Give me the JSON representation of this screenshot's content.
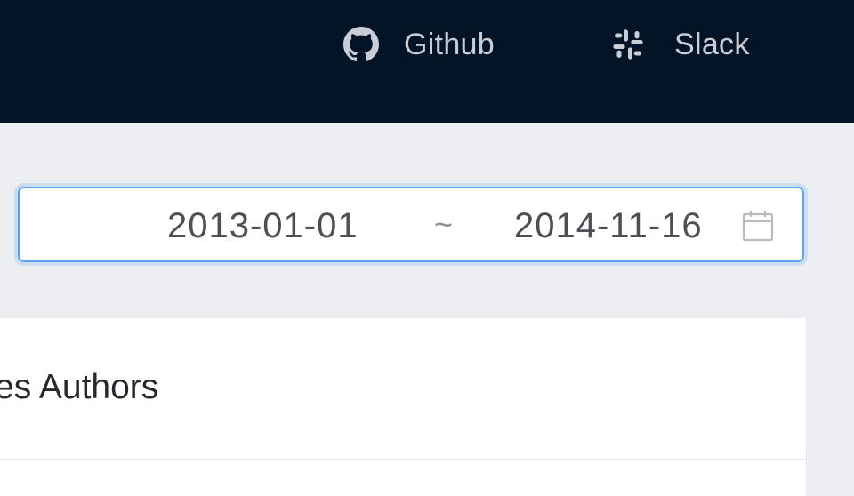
{
  "header": {
    "links": [
      {
        "label": "Github",
        "icon": "github-icon"
      },
      {
        "label": "Slack",
        "icon": "slack-icon"
      }
    ]
  },
  "date_range": {
    "start": "2013-01-01",
    "separator": "~",
    "end": "2014-11-16",
    "icon": "calendar-icon"
  },
  "card": {
    "title": "es Authors"
  },
  "colors": {
    "header_bg": "#041427",
    "page_bg": "#eceef1",
    "focus_border": "#5aa4ee"
  }
}
